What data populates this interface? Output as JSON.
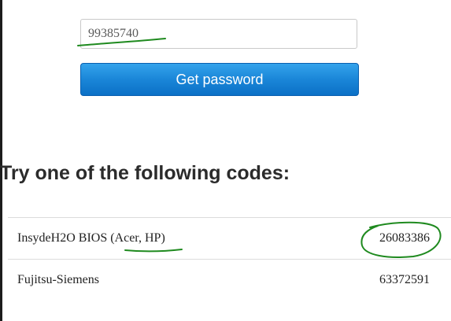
{
  "form": {
    "code_value": "99385740",
    "button_label": "Get password"
  },
  "heading": "Try one of the following codes:",
  "codes": [
    {
      "name": "InsydeH2O BIOS (Acer, HP)",
      "code": "26083386"
    },
    {
      "name": "Fujitsu-Siemens",
      "code": "63372591"
    }
  ],
  "colors": {
    "button": "#1a86d8",
    "annotation": "#1f8a1f"
  }
}
